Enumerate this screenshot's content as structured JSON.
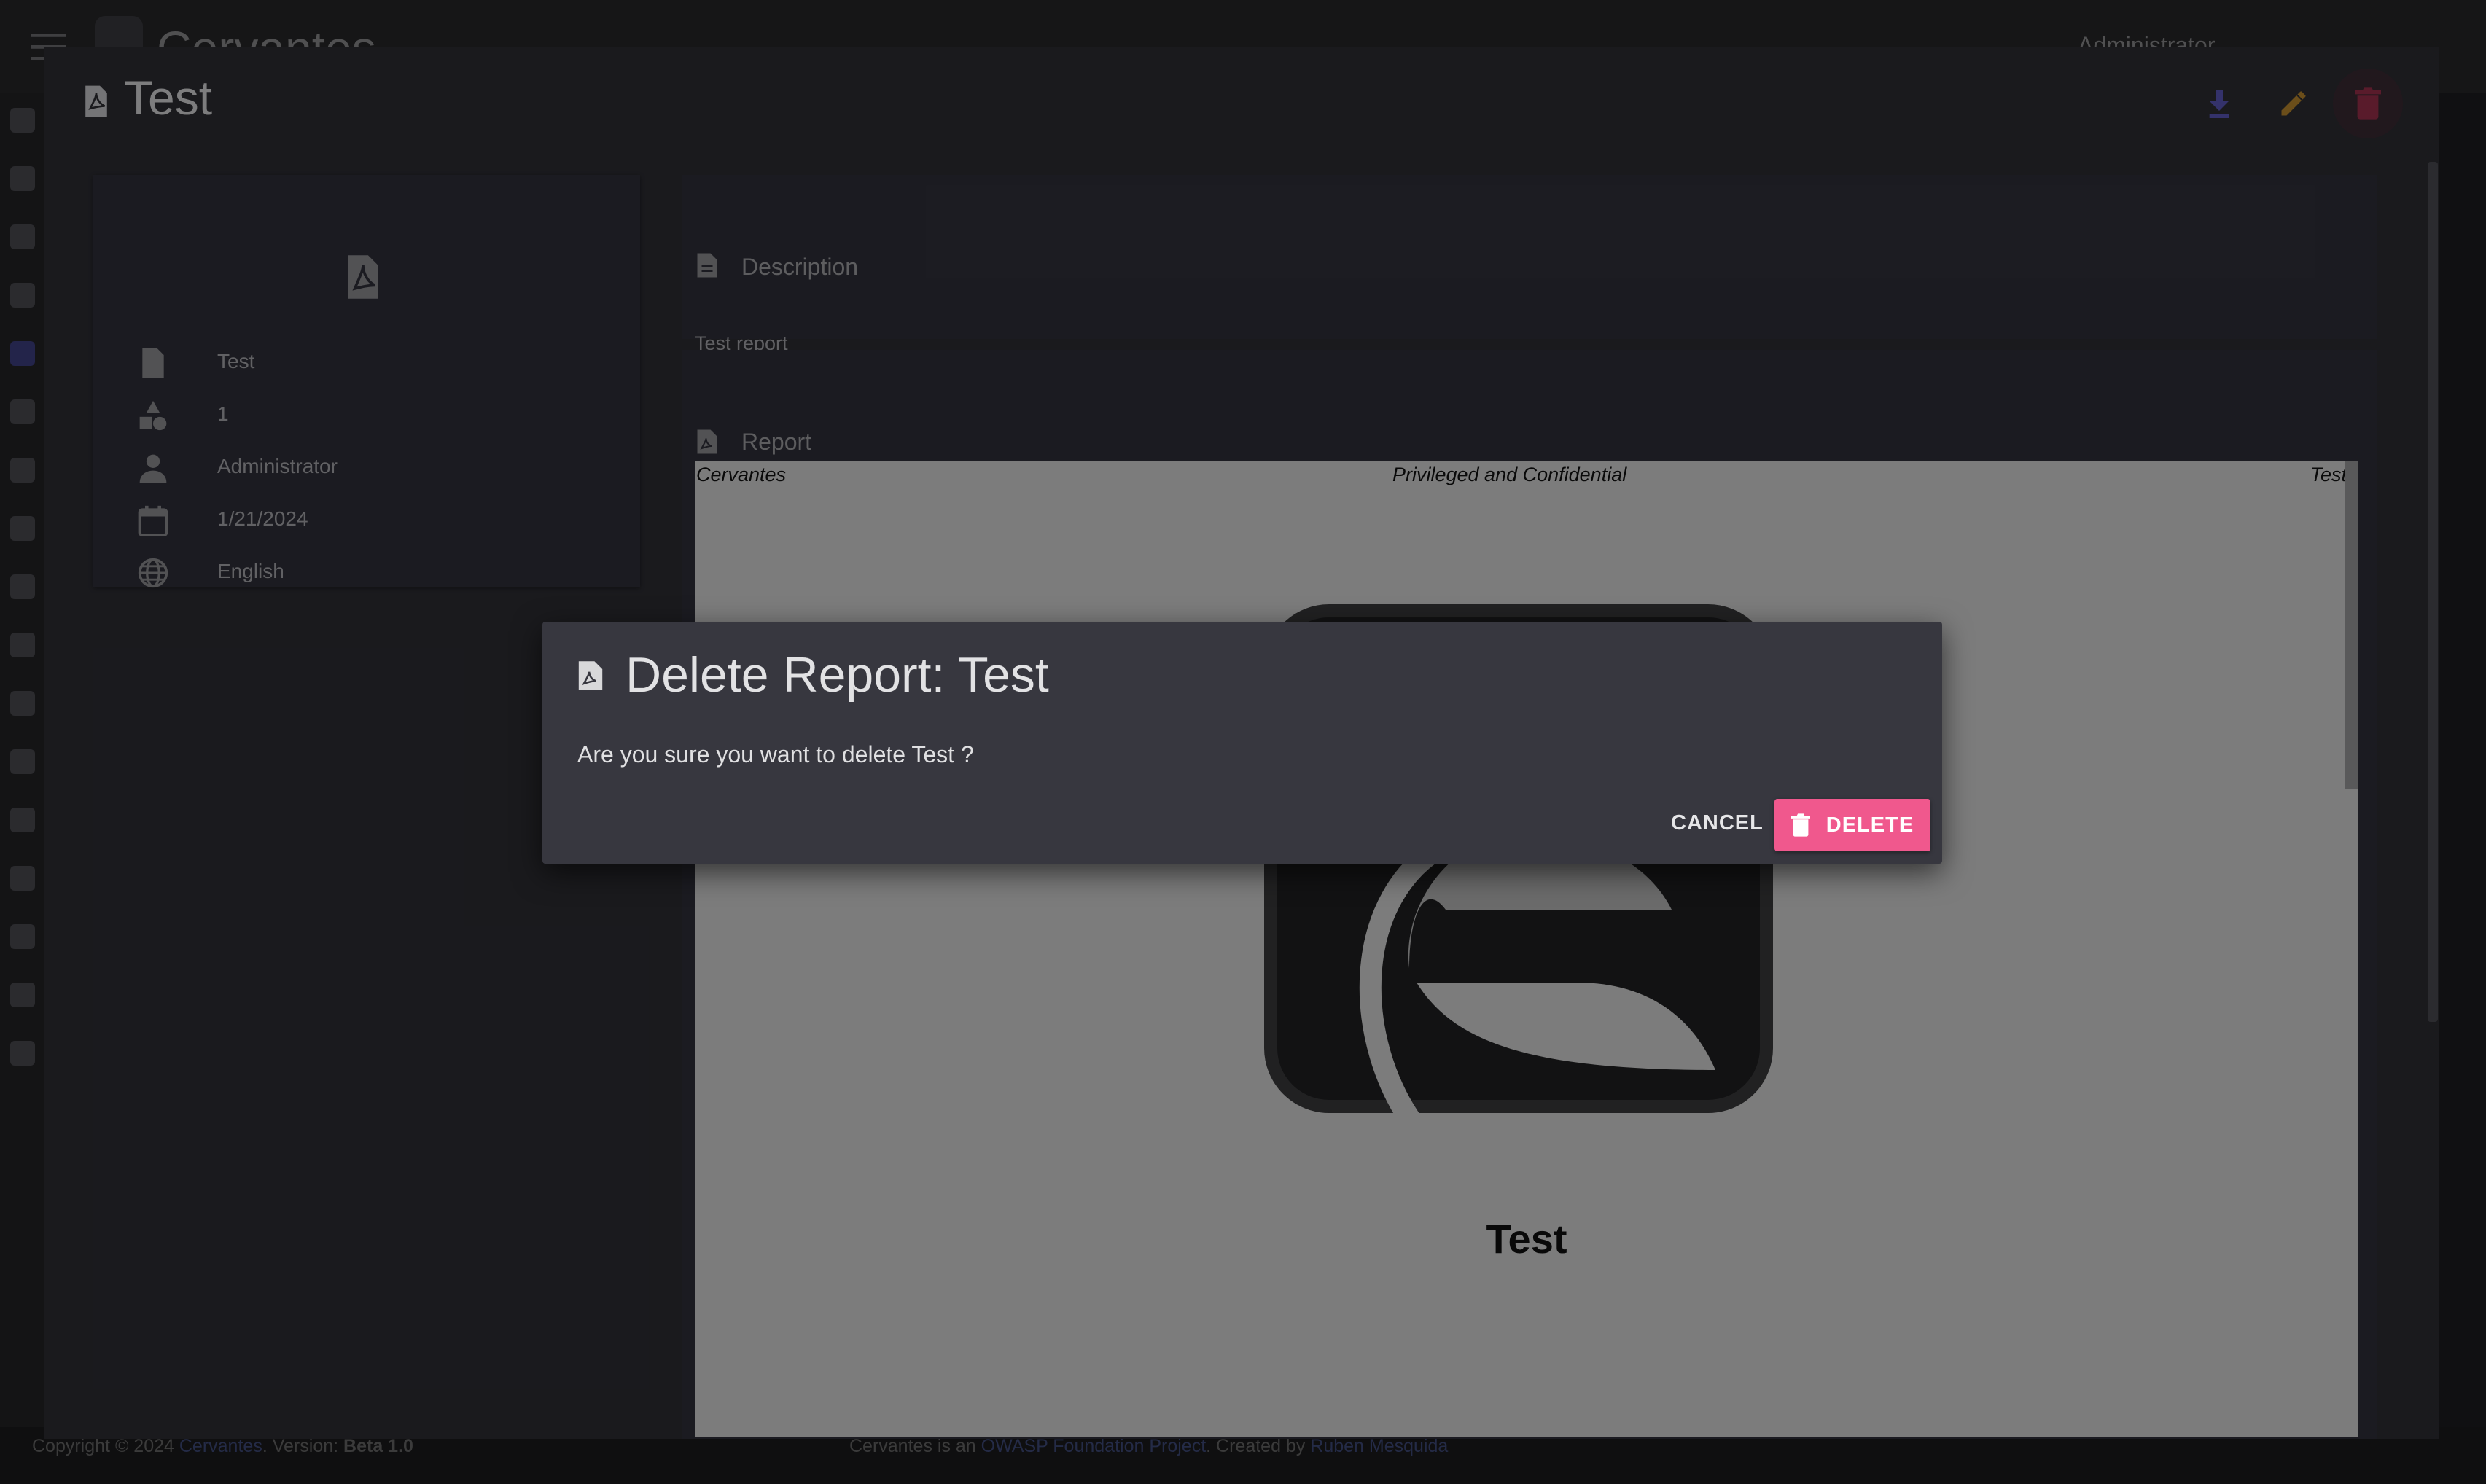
{
  "app": {
    "brand": "Cervantes",
    "user": "Administrator"
  },
  "footer": {
    "copyright": "Copyright © 2024",
    "brand_link": "Cervantes",
    "version_label": "Version:",
    "version": "Beta 1.0",
    "project_text": "Cervantes is an",
    "owasp_link": "OWASP Foundation Project",
    "created_by": ". Created by",
    "author_link": "Ruben Mesquida"
  },
  "detail": {
    "title": "Test",
    "meta": [
      {
        "icon": "pdf-icon",
        "value": "Test"
      },
      {
        "icon": "shapes-icon",
        "value": "1"
      },
      {
        "icon": "person-icon",
        "value": "Administrator"
      },
      {
        "icon": "calendar-icon",
        "value": "1/21/2024"
      },
      {
        "icon": "globe-icon",
        "value": "English"
      }
    ],
    "description_heading": "Description",
    "description_text": "Test report",
    "report_heading": "Report",
    "preview": {
      "header_left": "Cervantes",
      "header_center": "Privileged and Confidential",
      "header_right": "Test",
      "title": "Test"
    },
    "actions": {
      "download_icon": "download-icon",
      "edit_icon": "pencil-icon",
      "delete_icon": "trash-icon"
    },
    "colors": {
      "download": "#5b57b8",
      "edit": "#b8872e",
      "delete": "#9a2f4a"
    }
  },
  "confirm": {
    "title": "Delete Report: Test",
    "message": "Are you sure you want to delete Test ?",
    "cancel_label": "CANCEL",
    "delete_label": "DELETE",
    "delete_color": "#f0588d"
  }
}
